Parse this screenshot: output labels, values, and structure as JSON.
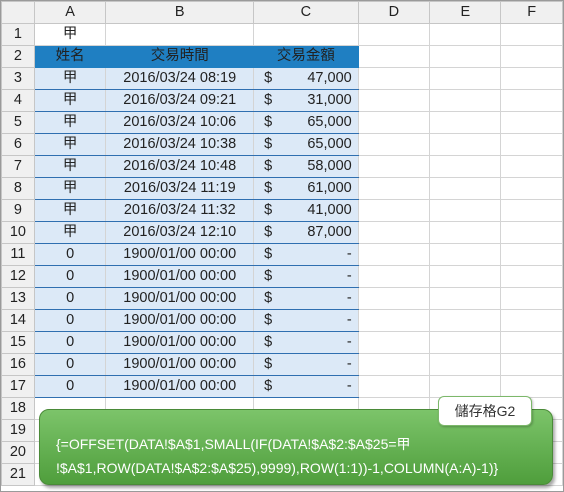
{
  "columns": [
    "A",
    "B",
    "C",
    "D",
    "E",
    "F"
  ],
  "rows": [
    "1",
    "2",
    "3",
    "4",
    "5",
    "6",
    "7",
    "8",
    "9",
    "10",
    "11",
    "12",
    "13",
    "14",
    "15",
    "16",
    "17",
    "18",
    "19",
    "20",
    "21"
  ],
  "a1_value": "甲",
  "header": {
    "name": "姓名",
    "time": "交易時間",
    "amount": "交易金額"
  },
  "records": [
    {
      "name": "甲",
      "time": "2016/03/24 08:19",
      "currency": "$",
      "amount": "47,000"
    },
    {
      "name": "甲",
      "time": "2016/03/24 09:21",
      "currency": "$",
      "amount": "31,000"
    },
    {
      "name": "甲",
      "time": "2016/03/24 10:06",
      "currency": "$",
      "amount": "65,000"
    },
    {
      "name": "甲",
      "time": "2016/03/24 10:38",
      "currency": "$",
      "amount": "65,000"
    },
    {
      "name": "甲",
      "time": "2016/03/24 10:48",
      "currency": "$",
      "amount": "58,000"
    },
    {
      "name": "甲",
      "time": "2016/03/24 11:19",
      "currency": "$",
      "amount": "61,000"
    },
    {
      "name": "甲",
      "time": "2016/03/24 11:32",
      "currency": "$",
      "amount": "41,000"
    },
    {
      "name": "甲",
      "time": "2016/03/24 12:10",
      "currency": "$",
      "amount": "87,000"
    },
    {
      "name": "0",
      "time": "1900/01/00 00:00",
      "currency": "$",
      "amount": "-"
    },
    {
      "name": "0",
      "time": "1900/01/00 00:00",
      "currency": "$",
      "amount": "-"
    },
    {
      "name": "0",
      "time": "1900/01/00 00:00",
      "currency": "$",
      "amount": "-"
    },
    {
      "name": "0",
      "time": "1900/01/00 00:00",
      "currency": "$",
      "amount": "-"
    },
    {
      "name": "0",
      "time": "1900/01/00 00:00",
      "currency": "$",
      "amount": "-"
    },
    {
      "name": "0",
      "time": "1900/01/00 00:00",
      "currency": "$",
      "amount": "-"
    },
    {
      "name": "0",
      "time": "1900/01/00 00:00",
      "currency": "$",
      "amount": "-"
    }
  ],
  "callout": {
    "tag": "儲存格G2",
    "formula": "{=OFFSET(DATA!$A$1,SMALL(IF(DATA!$A$2:$A$25=甲\n!$A$1,ROW(DATA!$A$2:$A$25),9999),ROW(1:1))-1,COLUMN(A:A)-1)}"
  }
}
